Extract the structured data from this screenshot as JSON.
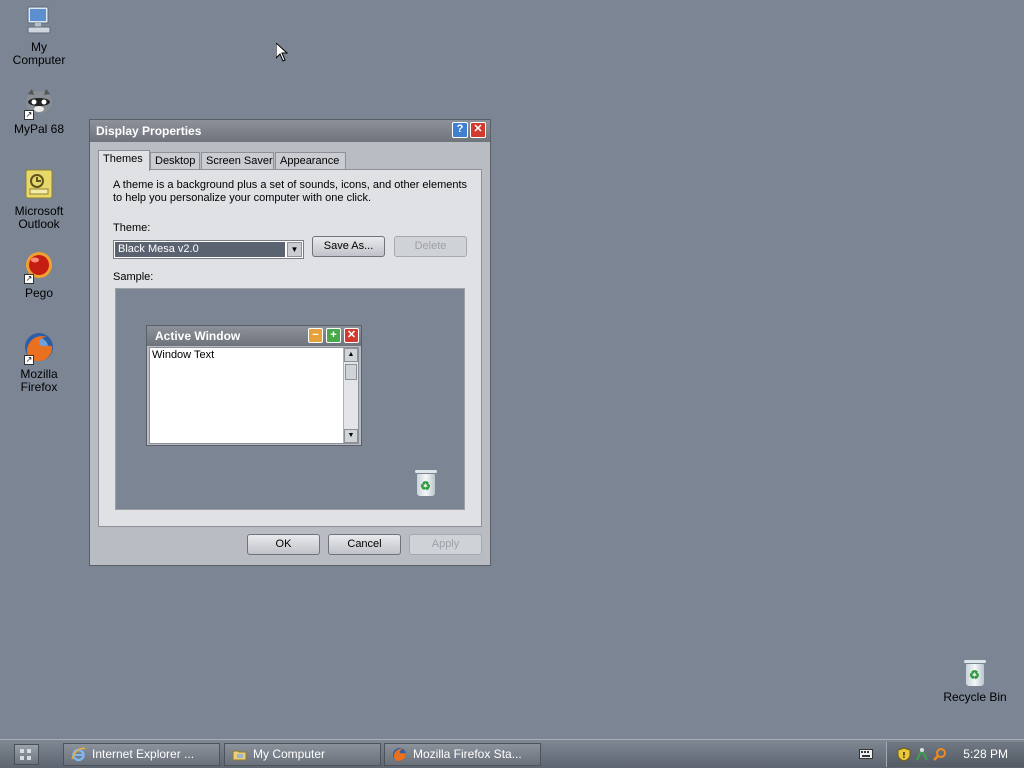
{
  "desktop": {
    "icons": [
      {
        "label_line1": "My",
        "label_line2": "Computer"
      },
      {
        "label_line1": "MyPal 68",
        "label_line2": ""
      },
      {
        "label_line1": "Microsoft",
        "label_line2": "Outlook"
      },
      {
        "label_line1": "Pego",
        "label_line2": ""
      },
      {
        "label_line1": "Mozilla",
        "label_line2": "Firefox"
      }
    ],
    "recycle_bin_label": "Recycle Bin"
  },
  "dialog": {
    "title": "Display Properties",
    "help_symbol": "?",
    "close_symbol": "✕",
    "tabs": [
      {
        "label": "Themes",
        "active": true
      },
      {
        "label": "Desktop",
        "active": false
      },
      {
        "label": "Screen Saver",
        "active": false
      },
      {
        "label": "Appearance",
        "active": false
      }
    ],
    "description_line1": "A theme is a background plus a set of sounds, icons, and other elements",
    "description_line2": "to help you personalize your computer with one click.",
    "theme_label": "Theme:",
    "theme_value": "Black Mesa v2.0",
    "save_as_label": "Save As...",
    "delete_label": "Delete",
    "sample_label": "Sample:",
    "sample_window": {
      "title": "Active Window",
      "text": "Window Text"
    },
    "ok_label": "OK",
    "cancel_label": "Cancel",
    "apply_label": "Apply"
  },
  "taskbar": {
    "tasks": [
      {
        "label": "Internet Explorer ..."
      },
      {
        "label": "My Computer"
      },
      {
        "label": "Mozilla Firefox Sta..."
      }
    ],
    "clock": "5:28 PM"
  },
  "colors": {
    "desktop": "#7b8594",
    "title_bar": "#6f747c",
    "close_button": "#d23a2e",
    "help_button": "#3f7fcf",
    "minimize_button": "#e6a23a",
    "maximize_button": "#4aa84a"
  }
}
